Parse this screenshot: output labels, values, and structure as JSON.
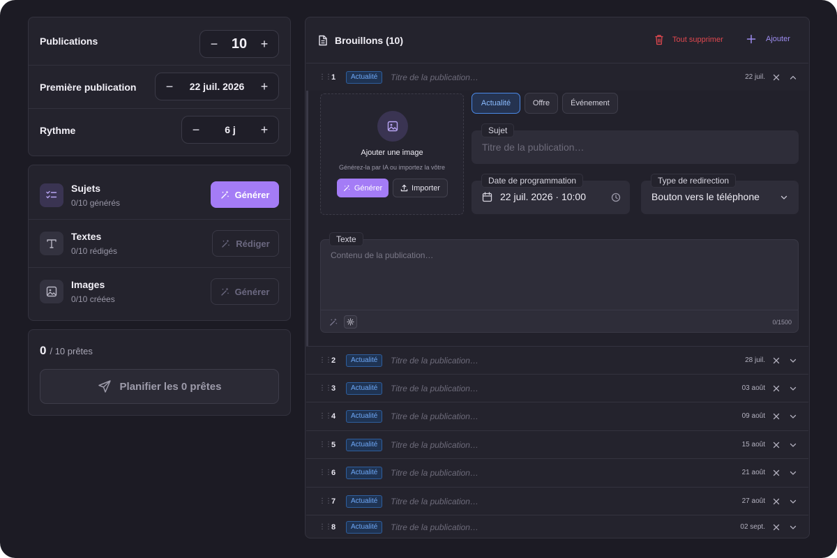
{
  "settings": {
    "publications_label": "Publications",
    "publications_value": "10",
    "first_pub_label": "Première publication",
    "first_pub_value": "22 juil. 2026",
    "rhythm_label": "Rythme",
    "rhythm_value": "6 j"
  },
  "steps": [
    {
      "title": "Sujets",
      "status": "0/10 générés",
      "button": "Générer",
      "icon": "checklist-icon",
      "button_state": "primary"
    },
    {
      "title": "Textes",
      "status": "0/10 rédigés",
      "button": "Rédiger",
      "icon": "text-icon",
      "button_state": "disabled"
    },
    {
      "title": "Images",
      "status": "0/10 créées",
      "button": "Générer",
      "icon": "image-icon",
      "button_state": "disabled"
    }
  ],
  "ready": {
    "count": "0",
    "total_text": "/ 10 prêtes",
    "plan_button": "Planifier les 0 prêtes"
  },
  "drafts": {
    "title": "Brouillons (10)",
    "delete_all": "Tout supprimer",
    "add": "Ajouter",
    "tag": "Actualité",
    "title_placeholder": "Titre de la publication…",
    "rows": [
      {
        "num": "1",
        "date": "22 juil."
      },
      {
        "num": "2",
        "date": "28 juil."
      },
      {
        "num": "3",
        "date": "03 août"
      },
      {
        "num": "4",
        "date": "09 août"
      },
      {
        "num": "5",
        "date": "15 août"
      },
      {
        "num": "6",
        "date": "21 août"
      },
      {
        "num": "7",
        "date": "27 août"
      },
      {
        "num": "8",
        "date": "02 sept."
      }
    ]
  },
  "editor": {
    "upload_title": "Ajouter une image",
    "upload_hint": "Générez-la par IA ou importez la vôtre",
    "upload_generate": "Générer",
    "upload_import": "Importer",
    "types": [
      "Actualité",
      "Offre",
      "Événement"
    ],
    "selected_type": "Actualité",
    "subject_label": "Sujet",
    "subject_placeholder": "Titre de la publication…",
    "schedule_label": "Date de programmation",
    "schedule_value": "22 juil. 2026 · 10:00",
    "redirect_label": "Type de redirection",
    "redirect_value": "Bouton vers le téléphone",
    "text_label": "Texte",
    "text_placeholder": "Contenu de la publication…",
    "char_count": "0/1500"
  },
  "colors": {
    "accent": "#a47cf6",
    "danger": "#e0484f",
    "link": "#9d8cf0",
    "tag": "#6ea8f7"
  }
}
